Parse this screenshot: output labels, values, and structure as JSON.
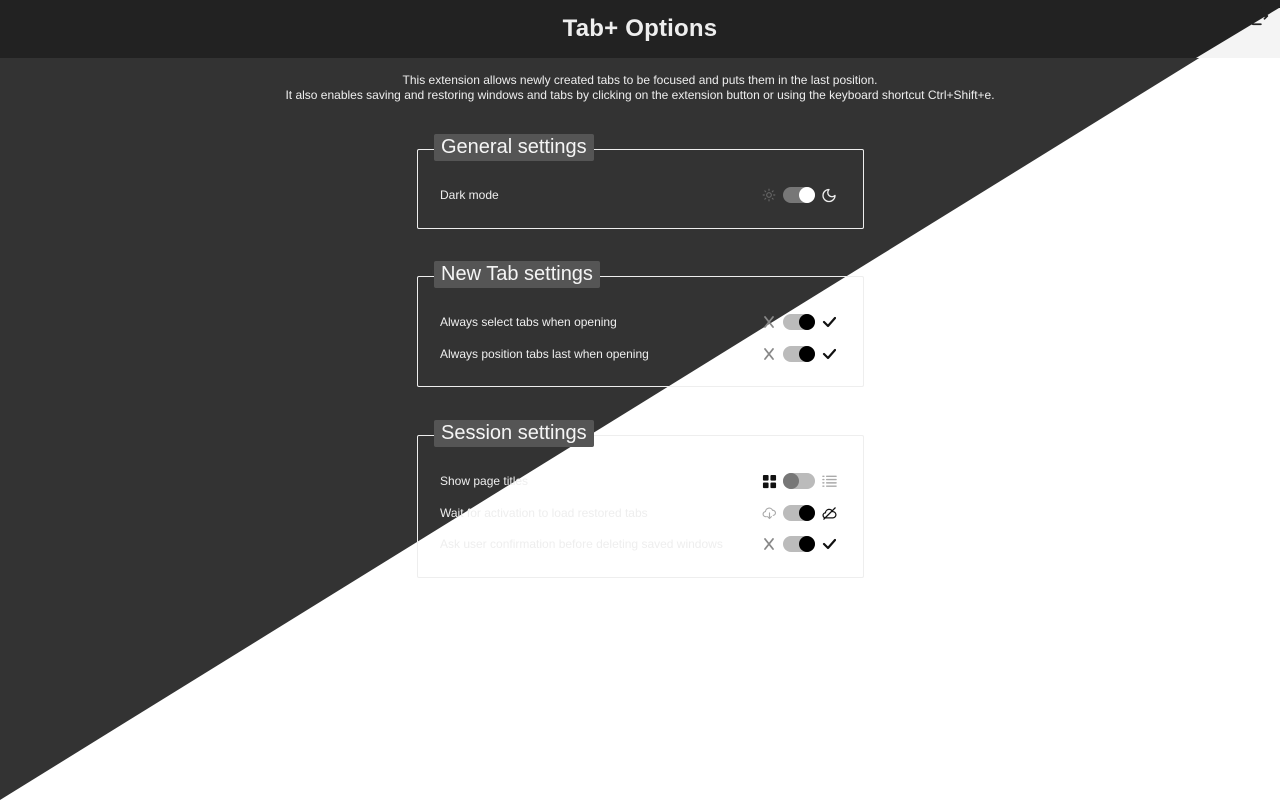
{
  "header": {
    "title": "Tab+ Options",
    "exit_icon": "exit-icon"
  },
  "description": {
    "line1": "This extension allows newly created tabs to be focused and puts them in the last position.",
    "line2": "It also enables saving and restoring windows and tabs by clicking on the extension button or using the keyboard shortcut Ctrl+Shift+e."
  },
  "general": {
    "title": "General settings",
    "rows": [
      {
        "label": "Dark mode",
        "left_icon": "sun-icon",
        "right_icon": "moon-icon",
        "state": "on"
      }
    ]
  },
  "newtab": {
    "title": "New Tab settings",
    "rows": [
      {
        "label": "Always select tabs when opening",
        "left_icon": "x-icon",
        "right_icon": "check-icon",
        "state": "on"
      },
      {
        "label": "Always position tabs last when opening",
        "left_icon": "x-icon",
        "right_icon": "check-icon",
        "state": "on"
      }
    ]
  },
  "session": {
    "title": "Session settings",
    "rows": [
      {
        "label": "Show page titles",
        "left_icon": "grid-icon",
        "right_icon": "list-icon",
        "state": "off"
      },
      {
        "label": "Wait for activation to load restored tabs",
        "left_icon": "cloud-download-icon",
        "right_icon": "cloud-off-icon",
        "state": "on"
      },
      {
        "label": "Ask user confirmation before deleting saved windows",
        "left_icon": "x-icon",
        "right_icon": "check-icon",
        "state": "on"
      }
    ]
  },
  "colors": {
    "dark_bg": "#333333",
    "header_bg": "#222222",
    "light_bg": "#ffffff",
    "title_bg": "#555555"
  }
}
